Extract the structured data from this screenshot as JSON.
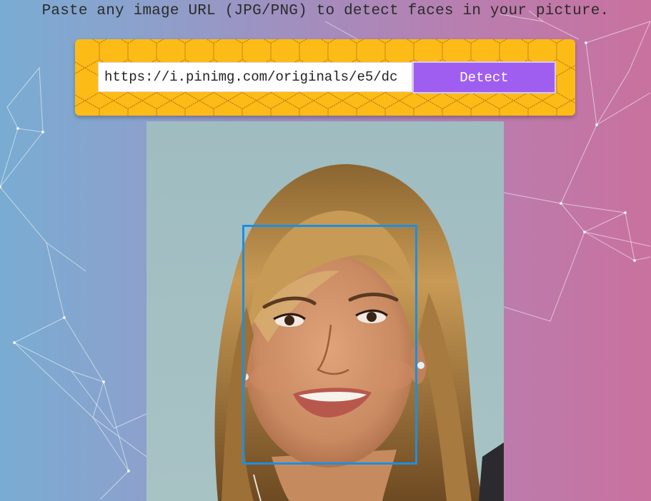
{
  "instruction": "Paste any image URL (JPG/PNG) to detect faces in your picture.",
  "form": {
    "url_value": "https://i.pinimg.com/originals/e5/dc",
    "detect_label": "Detect"
  },
  "colors": {
    "panel_yellow": "#fdbb17",
    "button_purple": "#a05ef0",
    "face_box_blue": "#1b8fe3"
  },
  "detection": {
    "faces_detected": 1
  }
}
